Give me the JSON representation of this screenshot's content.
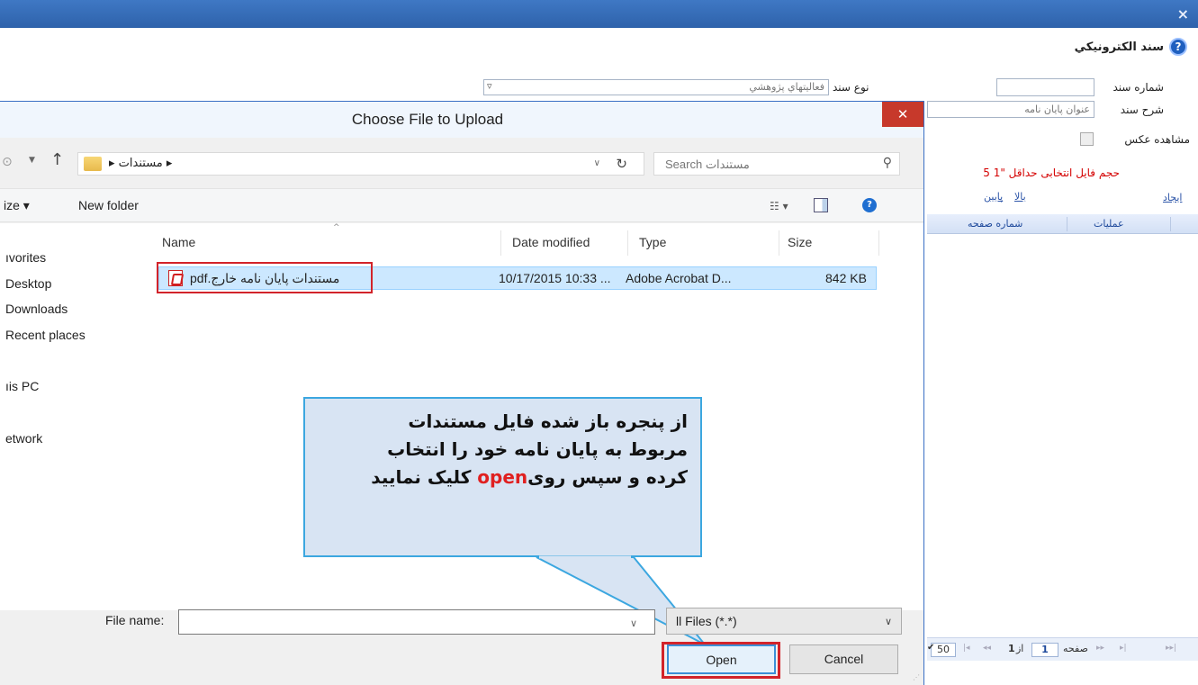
{
  "background": {
    "close_glyph": "×",
    "title": "سند الكترونيكي",
    "help_glyph": "?",
    "doc_number_label": "شماره سند",
    "doc_type_label": "نوع سند",
    "doc_type_value": "فعاليتهاي پژوهشي",
    "doc_desc_label": "شرح سند",
    "doc_desc_value": "عنوان پايان نامه",
    "show_image_label": "مشاهده عکس",
    "file_size_note": "حجم فايل انتخابی حداقل \"1 5",
    "link_create": "ایجاد",
    "link_up": "بالا",
    "link_down": "پایین",
    "grid_cols": [
      "عمليات",
      "شماره صفحه"
    ],
    "pager": {
      "page_size": "50",
      "page_label": "صفحه",
      "page_value": "1",
      "of_label": "از",
      "total": "1"
    }
  },
  "dialog": {
    "title": "Choose File to Upload",
    "close_glyph": "✕",
    "address_path": "مستندات",
    "search_placeholder": "Search مستندات",
    "toolbar": {
      "organize": "ize ▾",
      "new_folder": "New folder"
    },
    "nav_items": [
      "ıvorites",
      "Desktop",
      "Downloads",
      "Recent places",
      "ıis PC",
      "etwork"
    ],
    "columns": {
      "name": "Name",
      "date": "Date modified",
      "type": "Type",
      "size": "Size"
    },
    "file": {
      "name": "مستندات پایان نامه خارج.pdf",
      "date": "10/17/2015 10:33 ...",
      "type": "Adobe Acrobat D...",
      "size": "842 KB"
    },
    "filename_label": "File name:",
    "filename_value": "",
    "filter_value": "ll Files (*.*)",
    "open_label": "Open",
    "cancel_label": "Cancel"
  },
  "callout": {
    "line1": "از پنجره باز شده فایل مستندات",
    "line2": "مربوط به پایان نامه خود را انتخاب",
    "line3_before": "کرده و سپس روی",
    "line3_keyword": "open",
    "line3_after": " کلیک نمایید"
  },
  "colors": {
    "titlebar": "#2e62ab",
    "accent_red": "#d2232a",
    "callout_bg": "#d8e4f3",
    "callout_border": "#3ca7e0",
    "selection": "#cce8ff"
  }
}
